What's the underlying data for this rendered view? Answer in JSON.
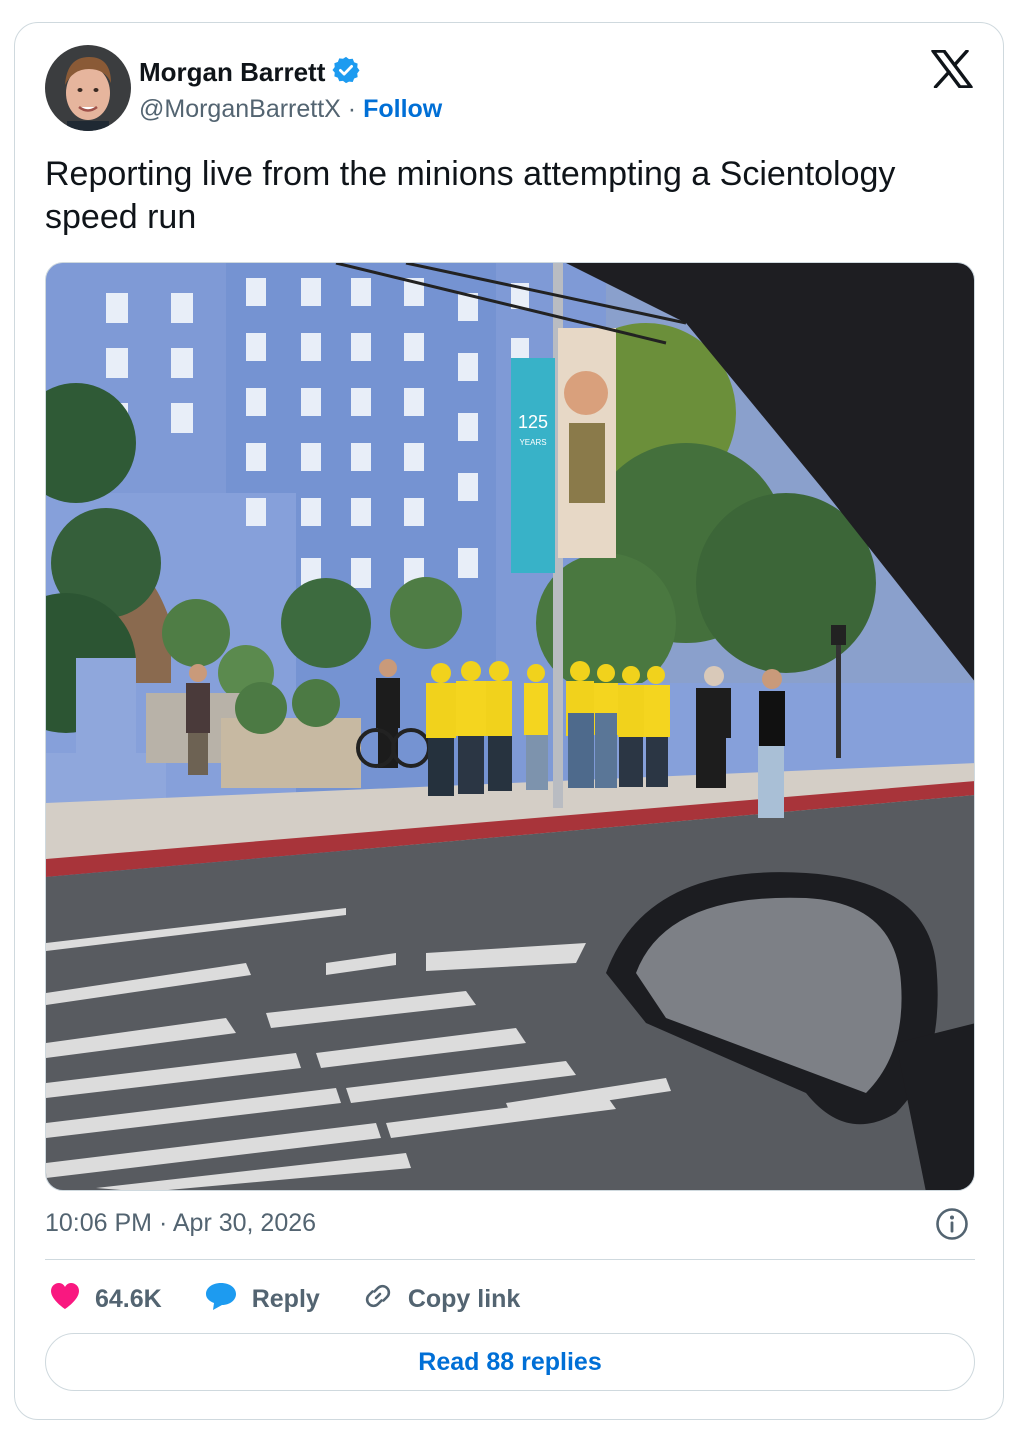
{
  "author": {
    "name": "Morgan Barrett",
    "handle": "@MorganBarrettX",
    "separator": "·",
    "follow_label": "Follow",
    "verified_color": "#1d9bf0"
  },
  "platform_logo": "x-logo-icon",
  "tweet": {
    "text": "Reporting live from the minions attempting a Scientology speed run",
    "banner_years": "125",
    "banner_years_label": "YEARS"
  },
  "meta": {
    "time": "10:06 PM",
    "separator": "·",
    "date": "Apr 30, 2026"
  },
  "actions": {
    "likes": "64.6K",
    "reply_label": "Reply",
    "copy_label": "Copy link"
  },
  "read_replies_label": "Read 88 replies",
  "colors": {
    "link": "#006fd6",
    "heart": "#f91880",
    "reply": "#1d9bf0",
    "muted": "#536471",
    "border": "#cfd9de"
  }
}
